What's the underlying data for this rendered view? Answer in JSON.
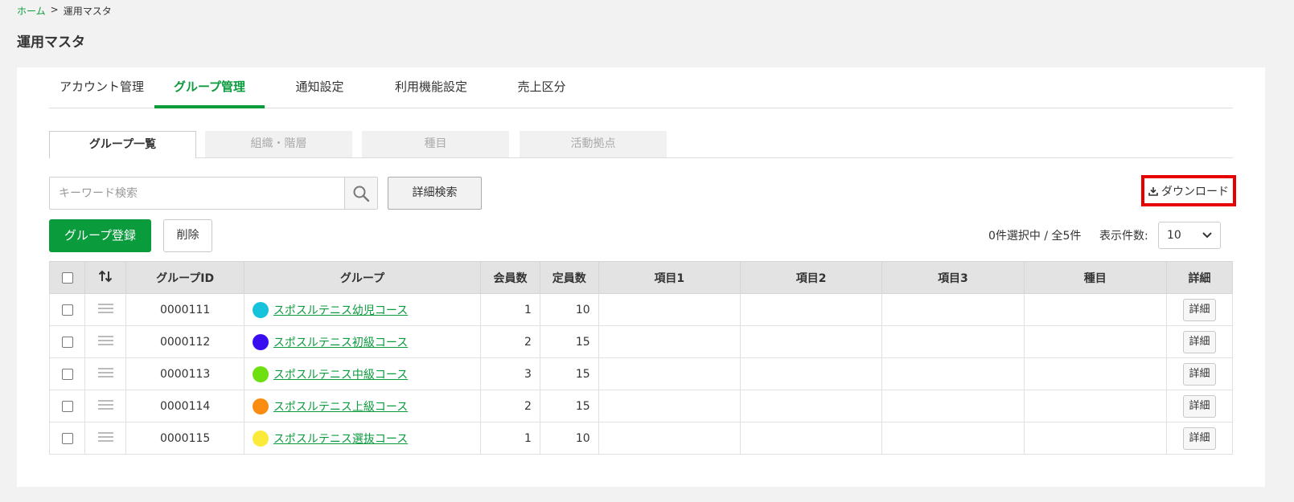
{
  "breadcrumb": {
    "home": "ホーム",
    "sep": ">",
    "current": "運用マスタ"
  },
  "page": {
    "title": "運用マスタ"
  },
  "tabs": [
    {
      "label": "アカウント管理"
    },
    {
      "label": "グループ管理"
    },
    {
      "label": "通知設定"
    },
    {
      "label": "利用機能設定"
    },
    {
      "label": "売上区分"
    }
  ],
  "subtabs": [
    {
      "label": "グループ一覧"
    },
    {
      "label": "組織・階層"
    },
    {
      "label": "種目"
    },
    {
      "label": "活動拠点"
    }
  ],
  "search": {
    "placeholder": "キーワード検索",
    "advanced_label": "詳細検索"
  },
  "actions": {
    "download_label": "ダウンロード",
    "register_label": "グループ登録",
    "delete_label": "削除"
  },
  "selection": {
    "info": "0件選択中 / 全5件",
    "per_page_label": "表示件数:",
    "per_page_value": "10"
  },
  "table": {
    "headers": {
      "group_id": "グループID",
      "group": "グループ",
      "members": "会員数",
      "capacity": "定員数",
      "item1": "項目1",
      "item2": "項目2",
      "item3": "項目3",
      "type": "種目",
      "detail": "詳細"
    },
    "detail_label": "詳細",
    "rows": [
      {
        "id": "0000111",
        "name": "スポスルテニス幼児コース",
        "color": "#17c3da",
        "members": "1",
        "capacity": "10"
      },
      {
        "id": "0000112",
        "name": "スポスルテニス初級コース",
        "color": "#3a0cf0",
        "members": "2",
        "capacity": "15"
      },
      {
        "id": "0000113",
        "name": "スポスルテニス中級コース",
        "color": "#6ee012",
        "members": "3",
        "capacity": "15"
      },
      {
        "id": "0000114",
        "name": "スポスルテニス上級コース",
        "color": "#fb8c12",
        "members": "2",
        "capacity": "15"
      },
      {
        "id": "0000115",
        "name": "スポスルテニス選抜コース",
        "color": "#fcea3a",
        "members": "1",
        "capacity": "10"
      }
    ]
  },
  "colors": {
    "accent": "#0a9b3c",
    "highlight": "#e60000"
  }
}
